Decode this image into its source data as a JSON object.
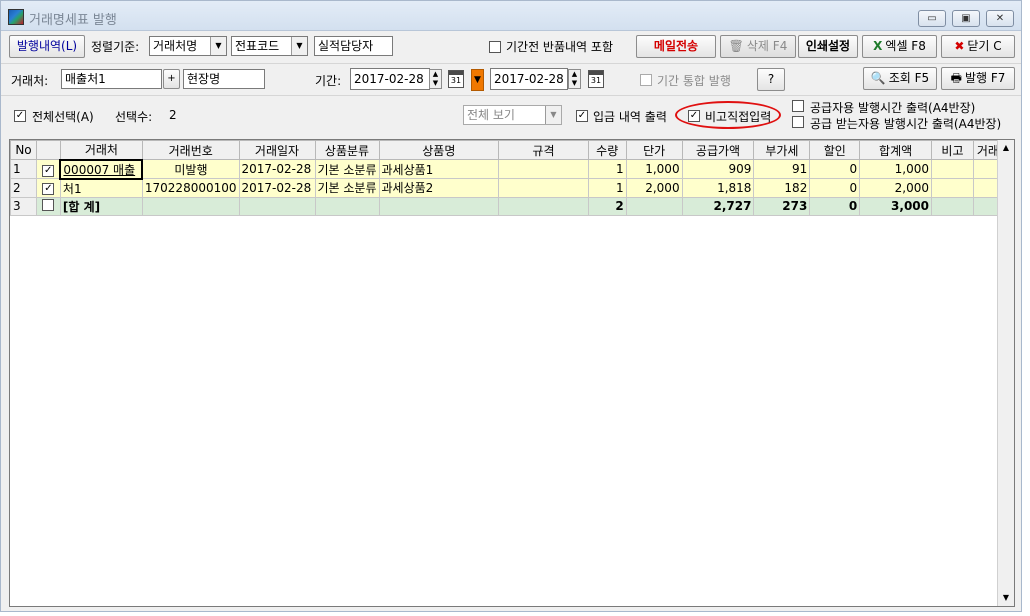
{
  "window": {
    "title": "거래명세표 발행",
    "controls": {
      "minimize": "▭",
      "restore": "▣",
      "close": "✕"
    }
  },
  "toolbar1": {
    "history_button": "발행내역(L)",
    "sort_label": "정렬기준:",
    "sort1": "거래처명",
    "sort2": "전표코드",
    "performance_manager": "실적담당자",
    "include_returns_label": "기간전 반품내역 포함",
    "mail_button": "메일전송",
    "delete_button": "삭제 F4",
    "print_settings_button": "인쇄설정",
    "excel_button": "엑셀 F8",
    "close_button": "닫기 C"
  },
  "toolbar2": {
    "client_label": "거래처:",
    "client_value": "매출처1",
    "client_plus": "+",
    "site_value": "현장명",
    "period_label": "기간:",
    "date_from": "2017-02-28",
    "date_to": "2017-02-28",
    "calendar_text": "31",
    "merge_period_label": "기간 통합 발행",
    "help_button": "?",
    "search_button": "조회 F5",
    "issue_button": "발행 F7"
  },
  "toolbar3": {
    "select_all_label": "전체선택(A)",
    "selected_count_label": "선택수:",
    "selected_count": "2",
    "view_select": "전체 보기",
    "deposit_print_label": "입금 내역 출력",
    "memo_input_label": "비고직접입력",
    "supplier_time_label": "공급자용 발행시간 출력(A4반장)",
    "receiver_time_label": "공급 받는자용 발행시간 출력(A4반장)"
  },
  "grid": {
    "columns": [
      "No",
      "",
      "거래처",
      "거래번호",
      "거래일자",
      "상품분류",
      "상품명",
      "규격",
      "수량",
      "단가",
      "공급가액",
      "부가세",
      "할인",
      "합계액",
      "비고",
      "거래처"
    ],
    "rows": [
      {
        "no": "1",
        "checked": true,
        "client": "000007 매출",
        "trade_no": "미발행",
        "date": "2017-02-28",
        "category": "기본 소분류",
        "product": "과세상품1",
        "spec": "",
        "qty": "1",
        "price": "1,000",
        "supply": "909",
        "vat": "91",
        "discount": "0",
        "total": "1,000",
        "memo": "",
        "client2": ""
      },
      {
        "no": "2",
        "checked": true,
        "client": "처1",
        "trade_no": "170228000100",
        "date": "2017-02-28",
        "category": "기본 소분류",
        "product": "과세상품2",
        "spec": "",
        "qty": "1",
        "price": "2,000",
        "supply": "1,818",
        "vat": "182",
        "discount": "0",
        "total": "2,000",
        "memo": "",
        "client2": ""
      }
    ],
    "summary": {
      "no": "3",
      "label": "[합 계]",
      "qty": "2",
      "supply": "2,727",
      "vat": "273",
      "discount": "0",
      "total": "3,000"
    }
  },
  "colors": {
    "mail_red": "#d40000",
    "row_yellow": "#ffffcc",
    "sum_green": "#d8ecd8",
    "annotation_red": "#e01010"
  }
}
